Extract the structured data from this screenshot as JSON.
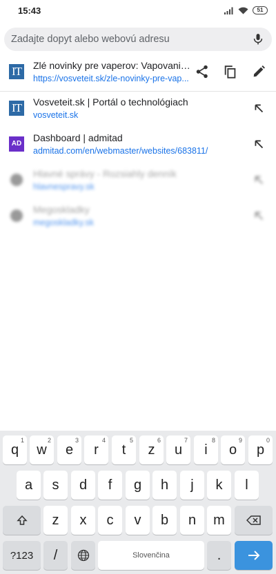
{
  "status_bar": {
    "time": "15:43",
    "battery": "51"
  },
  "search": {
    "placeholder": "Zadajte dopyt alebo webovú adresu",
    "value": ""
  },
  "suggestions": [
    {
      "title": "Zlé novinky pre vaperov: Vapovanie...",
      "url": "https://vosveteit.sk/zle-novinky-pre-vap...",
      "icon": "vosveteit-logo-icon",
      "icon_text": "IT"
    },
    {
      "title": "Vosveteit.sk | Portál o technológiach",
      "url": "vosveteit.sk",
      "icon": "vosveteit-logo-icon",
      "icon_text": "IT"
    },
    {
      "title": "Dashboard | admitad",
      "url": "admitad.com/en/webmaster/websites/683811/",
      "icon": "admitad-logo-icon",
      "icon_text": "AD"
    },
    {
      "title": "Hlavné správy - Rozsiahly denník",
      "url": "hlavnespravy.sk",
      "icon": "globe-icon"
    },
    {
      "title": "Megoskladky",
      "url": "megoskladky.sk",
      "icon": "globe-icon"
    }
  ],
  "actions": {
    "share_icon": "share-icon",
    "copy_icon": "copy-icon",
    "edit_icon": "edit-icon",
    "fill_icon": "arrow-up-left-icon"
  },
  "keyboard": {
    "row1": [
      {
        "k": "q",
        "n": "1"
      },
      {
        "k": "w",
        "n": "2"
      },
      {
        "k": "e",
        "n": "3"
      },
      {
        "k": "r",
        "n": "4"
      },
      {
        "k": "t",
        "n": "5"
      },
      {
        "k": "z",
        "n": "6"
      },
      {
        "k": "u",
        "n": "7"
      },
      {
        "k": "i",
        "n": "8"
      },
      {
        "k": "o",
        "n": "9"
      },
      {
        "k": "p",
        "n": "0"
      }
    ],
    "row2": [
      "a",
      "s",
      "d",
      "f",
      "g",
      "h",
      "j",
      "k",
      "l"
    ],
    "row3": [
      "z",
      "x",
      "c",
      "v",
      "b",
      "n",
      "m"
    ],
    "symbols_label": "?123",
    "slash_label": "/",
    "space_label": "Slovenčina",
    "period_label": "."
  },
  "colors": {
    "accent": "#1a73e8",
    "enter_key": "#3b93de",
    "it_logo": "#2d6aa6",
    "admitad_logo": "#6a2fc9"
  }
}
